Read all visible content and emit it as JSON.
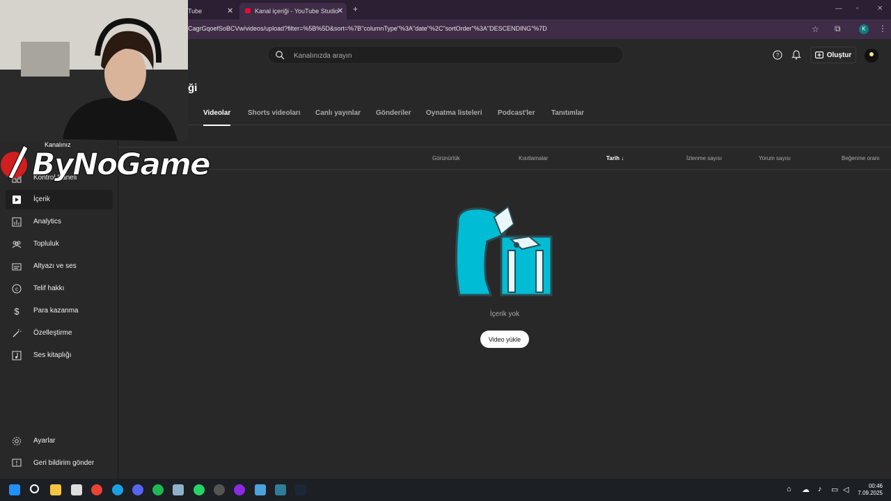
{
  "browser": {
    "tabs": [
      {
        "label": "Tube"
      },
      {
        "label": "Kanal içeriği - YouTube Studio"
      }
    ],
    "new_tab": "+",
    "url": "CagrGqoefSoBCVw/videos/upload?filter=%5B%5D&sort=%7B\"columnType\"%3A\"date\"%2C\"sortOrder\"%3A\"DESCENDING\"%7D",
    "profile_initial": "K"
  },
  "header": {
    "search_placeholder": "Kanalınızda arayın",
    "create_label": "Oluştur"
  },
  "page": {
    "title_tail": "ği"
  },
  "tabs": [
    {
      "label": "Videolar"
    },
    {
      "label": "Shorts videoları"
    },
    {
      "label": "Canlı yayınlar"
    },
    {
      "label": "Gönderiler"
    },
    {
      "label": "Oynatma listeleri"
    },
    {
      "label": "Podcast'ler"
    },
    {
      "label": "Tanıtımlar"
    }
  ],
  "columns": [
    {
      "label": "Görünürlük"
    },
    {
      "label": "Kısıtlamalar"
    },
    {
      "label": "Tarih ↓"
    },
    {
      "label": "İzlenme sayısı"
    },
    {
      "label": "Yorum sayısı"
    },
    {
      "label": "Beğenme oranı"
    }
  ],
  "sidebar": {
    "items": [
      {
        "label": "Kontrol Paneli",
        "icon": "dashboard-icon"
      },
      {
        "label": "İçerik",
        "icon": "content-icon"
      },
      {
        "label": "Analytics",
        "icon": "analytics-icon"
      },
      {
        "label": "Topluluk",
        "icon": "community-icon"
      },
      {
        "label": "Altyazı ve ses",
        "icon": "subtitles-icon"
      },
      {
        "label": "Telif hakkı",
        "icon": "copyright-icon"
      },
      {
        "label": "Para kazanma",
        "icon": "dollar-icon"
      },
      {
        "label": "Özelleştirme",
        "icon": "wand-icon"
      },
      {
        "label": "Ses kitaplığı",
        "icon": "audio-library-icon"
      }
    ],
    "footer": [
      {
        "label": "Ayarlar",
        "icon": "gear-icon"
      },
      {
        "label": "Geri bildirim gönder",
        "icon": "feedback-icon"
      }
    ]
  },
  "overlay": {
    "channel_label": "Kanalınız",
    "logo_text": "ByNoGame"
  },
  "empty_state": {
    "text": "İçerik yok",
    "button": "Video yükle"
  },
  "taskbar": {
    "time": "00:46",
    "date": "7.09.2025"
  },
  "colors": {
    "chrome_tab_bar": "#2b1f33",
    "chrome_toolbar": "#3f2c47",
    "studio_bg": "#282828",
    "illustration_cyan": "#00bcd4"
  }
}
